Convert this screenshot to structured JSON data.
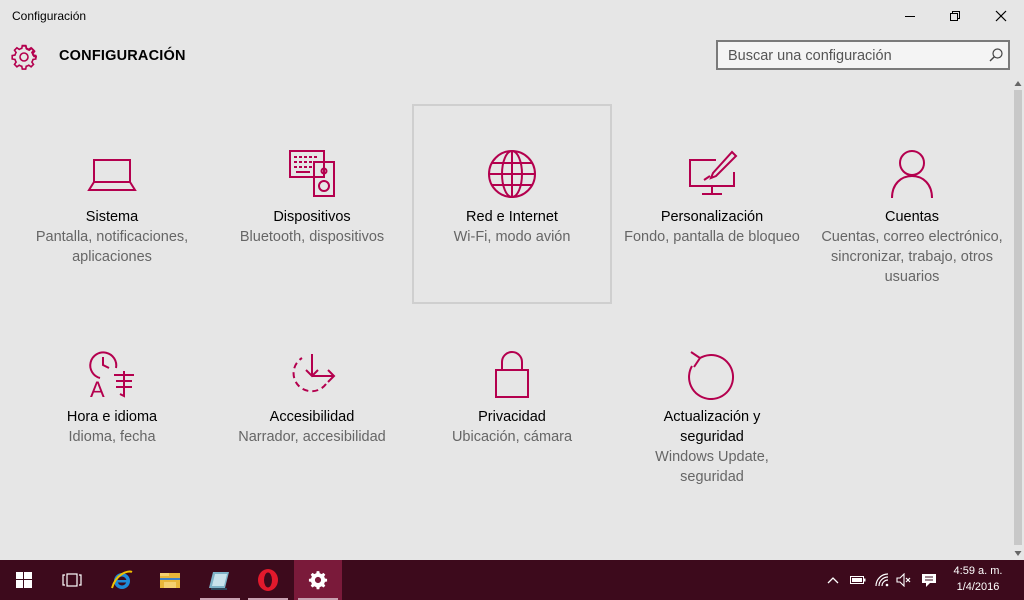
{
  "window": {
    "title": "Configuración"
  },
  "header": {
    "title": "CONFIGURACIÓN"
  },
  "search": {
    "placeholder": "Buscar una configuración"
  },
  "accent_color": "#b4004e",
  "tiles": [
    {
      "name": "Sistema",
      "desc": "Pantalla, notificaciones, aplicaciones",
      "icon": "laptop-icon"
    },
    {
      "name": "Dispositivos",
      "desc": "Bluetooth, dispositivos",
      "icon": "devices-icon"
    },
    {
      "name": "Red e Internet",
      "desc": "Wi-Fi, modo avión",
      "icon": "globe-icon"
    },
    {
      "name": "Personalización",
      "desc": "Fondo, pantalla de bloqueo",
      "icon": "personalization-icon"
    },
    {
      "name": "Cuentas",
      "desc": "Cuentas, correo electrónico, sincronizar, trabajo, otros usuarios",
      "icon": "person-icon"
    },
    {
      "name": "Hora e idioma",
      "desc": "Idioma, fecha",
      "icon": "time-language-icon"
    },
    {
      "name": "Accesibilidad",
      "desc": "Narrador, accesibilidad",
      "icon": "ease-of-access-icon"
    },
    {
      "name": "Privacidad",
      "desc": "Ubicación, cámara",
      "icon": "lock-icon"
    },
    {
      "name": "Actualización y seguridad",
      "desc": "Windows Update, seguridad",
      "icon": "update-icon"
    }
  ],
  "taskbar": {
    "items": [
      "start-icon",
      "task-view-icon",
      "internet-explorer-icon",
      "file-explorer-icon",
      "app-icon",
      "opera-icon",
      "settings-icon"
    ]
  },
  "clock": {
    "time": "4:59 a. m.",
    "date": "1/4/2016"
  }
}
